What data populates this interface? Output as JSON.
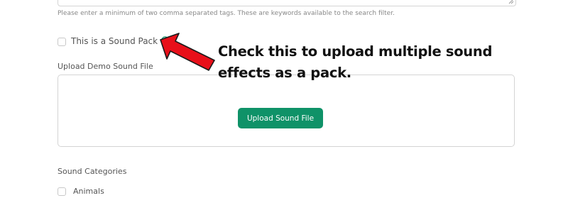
{
  "tags": {
    "help_text": "Please enter a minimum of two comma separated tags. These are keywords available to the search filter."
  },
  "sound_pack": {
    "label": "This is a Sound Pack",
    "checked": false,
    "info_icon": "info-circle-icon"
  },
  "demo_upload": {
    "label": "Upload Demo Sound File",
    "button_label": "Upload Sound File",
    "button_color": "#0f9268"
  },
  "categories": {
    "label": "Sound Categories",
    "items": [
      {
        "label": "Animals",
        "checked": false
      }
    ]
  },
  "annotation": {
    "text": "Check this to upload multiple sound effects as a pack.",
    "arrow_color": "#e8101a",
    "arrow_icon": "red-arrow-icon"
  }
}
